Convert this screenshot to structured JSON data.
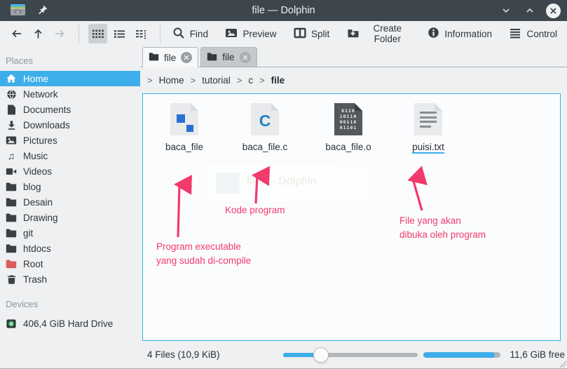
{
  "window": {
    "title": "file — Dolphin"
  },
  "toolbar": {
    "find": "Find",
    "preview": "Preview",
    "split": "Split",
    "create_folder": "Create Folder",
    "information": "Information",
    "control": "Control"
  },
  "tabs": [
    {
      "label": "file"
    },
    {
      "label": "file"
    }
  ],
  "breadcrumb": {
    "sep": ">",
    "items": [
      "Home",
      "tutorial",
      "c"
    ],
    "current": "file"
  },
  "sidebar": {
    "places_header": "Places",
    "places": [
      {
        "label": "Home",
        "icon": "home",
        "selected": true
      },
      {
        "label": "Network",
        "icon": "globe"
      },
      {
        "label": "Documents",
        "icon": "document"
      },
      {
        "label": "Downloads",
        "icon": "download"
      },
      {
        "label": "Pictures",
        "icon": "image"
      },
      {
        "label": "Music",
        "icon": "music-note"
      },
      {
        "label": "Videos",
        "icon": "video-camera"
      },
      {
        "label": "blog",
        "icon": "folder"
      },
      {
        "label": "Desain",
        "icon": "folder"
      },
      {
        "label": "Drawing",
        "icon": "folder"
      },
      {
        "label": "git",
        "icon": "folder"
      },
      {
        "label": "htdocs",
        "icon": "folder"
      },
      {
        "label": "Root",
        "icon": "folder-red"
      },
      {
        "label": "Trash",
        "icon": "trash"
      }
    ],
    "devices_header": "Devices",
    "devices": [
      {
        "label": "406,4 GiB Hard Drive",
        "icon": "hard-drive"
      }
    ]
  },
  "files": [
    {
      "name": "baca_file",
      "icon": "executable"
    },
    {
      "name": "baca_file.c",
      "icon": "c-source",
      "glyph": "C"
    },
    {
      "name": "baca_file.o",
      "icon": "object-code",
      "binary_rows": [
        "0110",
        "10110",
        "00110",
        "01101"
      ]
    },
    {
      "name": "puisi.txt",
      "icon": "text",
      "underlined": true
    }
  ],
  "annotations": {
    "executable": {
      "lines": [
        "Program executable",
        "yang sudah di-compile"
      ]
    },
    "source": {
      "lines": [
        "Kode program"
      ]
    },
    "target": {
      "lines": [
        "File yang akan",
        "dibuka oleh program"
      ]
    }
  },
  "statusbar": {
    "files_summary": "4 Files (10,9 KiB)",
    "free_space": "11,6 GiB free",
    "zoom_slider_percent": 28,
    "disk_fill_percent": 93
  },
  "colors": {
    "accent": "#3daee9",
    "annotation_pink": "#f23a6b",
    "titlebar": "#3e464d"
  }
}
